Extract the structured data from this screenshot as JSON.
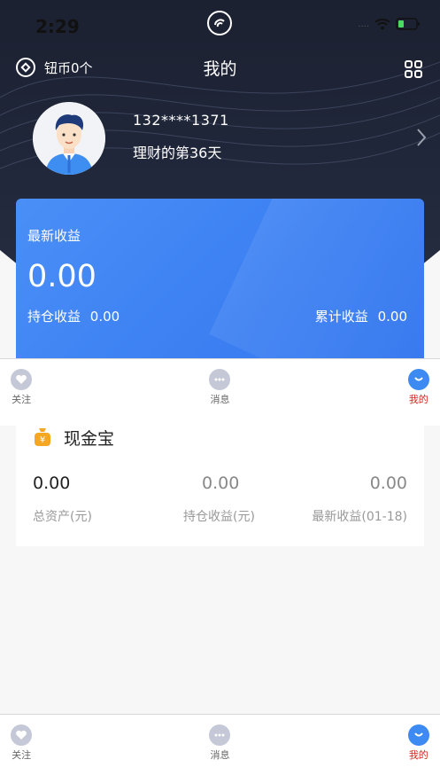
{
  "status_bar": {
    "time": "2:29",
    "dots": "...."
  },
  "header": {
    "coin_label": "钮币0个",
    "title": "我的"
  },
  "profile": {
    "phone": "132****1371",
    "days_text": "理财的第36天"
  },
  "income": {
    "label": "最新收益",
    "value": "0.00",
    "holding_label": "持仓收益",
    "holding_value": "0.00",
    "total_label": "累计收益",
    "total_value": "0.00"
  },
  "tabbar": {
    "items": [
      {
        "label": "关注",
        "icon": "heart-icon"
      },
      {
        "label": "消息",
        "icon": "chat-icon"
      },
      {
        "label": "我的",
        "icon": "profile-icon",
        "active": true
      }
    ]
  },
  "fund": {
    "name": "现金宝",
    "icon": "money-bag-icon",
    "metrics": [
      {
        "value": "0.00",
        "label": "总资产(元)"
      },
      {
        "value": "0.00",
        "label": "持仓收益(元)"
      },
      {
        "value": "0.00",
        "label": "最新收益(01-18)"
      }
    ]
  },
  "colors": {
    "header_bg": "#1c2131",
    "card_blue": "#3b7ff2",
    "active_tab": "#d9231f",
    "inactive_icon": "#c5c8d6",
    "active_icon": "#3d8bf2",
    "fund_icon": "#f5a623"
  }
}
